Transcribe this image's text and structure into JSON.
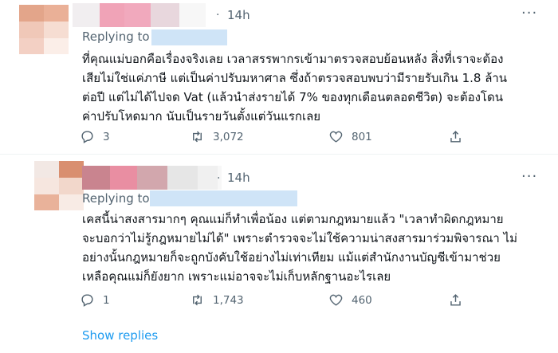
{
  "tweets": [
    {
      "time": "14h",
      "replying_label": "Replying to",
      "text_lines": [
        "ที่คุณแม่บอกคือเรื่องจริงเลย เวลาสรรพากรเข้ามาตรวจสอบย้อนหลัง สิ่งที่เราจะต้อง",
        "เสียไม่ใช่แค่ภาษี แต่เป็นค่าปรับมหาศาล ซึ่งถ้าตรวจสอบพบว่ามีรายรับเกิน 1.8 ล้าน",
        "ต่อปี แต่ไม่ได้ไปจด Vat (แล้วนำส่งรายได้ 7% ของทุกเดือนตลอดชีวิต) จะต้องโดน",
        "ค่าปรับโหดมาก นับเป็นรายวันตั้งแต่วันแรกเลย"
      ],
      "replies": "3",
      "retweets": "3,072",
      "likes": "801",
      "avatar_colors": [
        "#e3a58a",
        "#eab097",
        "#f0c8b8",
        "#f6ddd2",
        "#f3d0c4",
        "#fbeee8"
      ],
      "name_colors": [
        "#f1eef0",
        "#f0a3b7",
        "#f1a9bd",
        "#e8d7dd",
        "#f7f7f7"
      ]
    },
    {
      "time": "14h",
      "replying_label": "Replying to",
      "text_lines": [
        "เคสนี้น่าสงสารมากๆ คุณแม่ก็ทำเพื่อน้อง แต่ตามกฎหมายแล้ว \"เวลาทำผิดกฎหมาย",
        "จะบอกว่าไม่รู้กฎหมายไม่ได้\" เพราะตำรวจจะไม่ใช้ความน่าสงสารมาร่วมพิจารณา ไม่",
        "อย่างนั้นกฎหมายก็จะถูกบังคับใช้อย่างไม่เท่าเทียม แม้แต่สำนักงานบัญชีเข้ามาช่วย",
        "เหลือคุณแม่ก็ยังยาก เพราะแม่อาจจะไม่เก็บหลักฐานอะไรเลย"
      ],
      "replies": "1",
      "retweets": "1,743",
      "likes": "460",
      "avatar_colors": [
        "#f2e8e4",
        "#d98f70",
        "#f6e6df",
        "#f2d7cb",
        "#e9b29a",
        "#f8ebe5"
      ],
      "name_colors": [
        "#c9848f",
        "#e98ea2",
        "#d2a7ad",
        "#e6e6e6",
        "#f0f0f0",
        "#f7f7f7"
      ]
    }
  ],
  "show_replies": "Show replies",
  "separator": "·",
  "more_icon": "more-dots-icon"
}
